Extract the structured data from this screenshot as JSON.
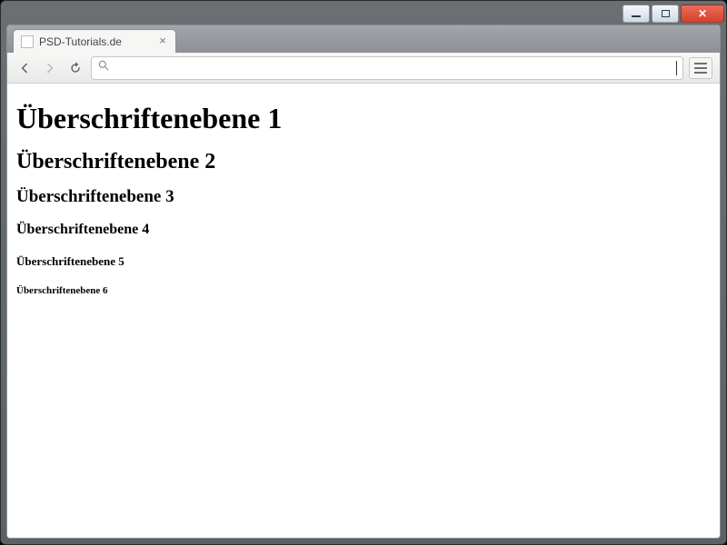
{
  "window": {
    "title": "PSD-Tutorials.de"
  },
  "tab": {
    "title": "PSD-Tutorials.de"
  },
  "omnibox": {
    "value": "",
    "placeholder": ""
  },
  "headings": {
    "h1": "Überschriftenebene 1",
    "h2": "Überschriftenebene 2",
    "h3": "Überschriftenebene 3",
    "h4": "Überschriftenebene 4",
    "h5": "Überschriftenebene 5",
    "h6": "Überschriftenebene 6"
  }
}
